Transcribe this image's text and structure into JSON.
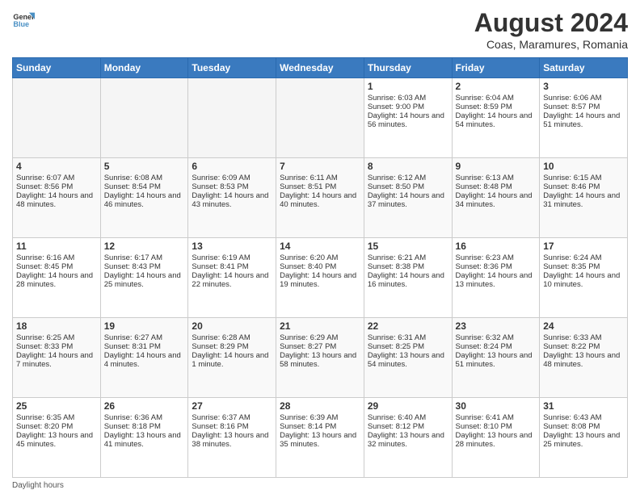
{
  "header": {
    "logo_text_general": "General",
    "logo_text_blue": "Blue",
    "month_year": "August 2024",
    "location": "Coas, Maramures, Romania"
  },
  "days_of_week": [
    "Sunday",
    "Monday",
    "Tuesday",
    "Wednesday",
    "Thursday",
    "Friday",
    "Saturday"
  ],
  "footer_label": "Daylight hours",
  "weeks": [
    [
      {
        "day": "",
        "sunrise": "",
        "sunset": "",
        "daylight": "",
        "empty": true
      },
      {
        "day": "",
        "sunrise": "",
        "sunset": "",
        "daylight": "",
        "empty": true
      },
      {
        "day": "",
        "sunrise": "",
        "sunset": "",
        "daylight": "",
        "empty": true
      },
      {
        "day": "",
        "sunrise": "",
        "sunset": "",
        "daylight": "",
        "empty": true
      },
      {
        "day": "1",
        "sunrise": "6:03 AM",
        "sunset": "9:00 PM",
        "daylight": "14 hours and 56 minutes."
      },
      {
        "day": "2",
        "sunrise": "6:04 AM",
        "sunset": "8:59 PM",
        "daylight": "14 hours and 54 minutes."
      },
      {
        "day": "3",
        "sunrise": "6:06 AM",
        "sunset": "8:57 PM",
        "daylight": "14 hours and 51 minutes."
      }
    ],
    [
      {
        "day": "4",
        "sunrise": "6:07 AM",
        "sunset": "8:56 PM",
        "daylight": "14 hours and 48 minutes."
      },
      {
        "day": "5",
        "sunrise": "6:08 AM",
        "sunset": "8:54 PM",
        "daylight": "14 hours and 46 minutes."
      },
      {
        "day": "6",
        "sunrise": "6:09 AM",
        "sunset": "8:53 PM",
        "daylight": "14 hours and 43 minutes."
      },
      {
        "day": "7",
        "sunrise": "6:11 AM",
        "sunset": "8:51 PM",
        "daylight": "14 hours and 40 minutes."
      },
      {
        "day": "8",
        "sunrise": "6:12 AM",
        "sunset": "8:50 PM",
        "daylight": "14 hours and 37 minutes."
      },
      {
        "day": "9",
        "sunrise": "6:13 AM",
        "sunset": "8:48 PM",
        "daylight": "14 hours and 34 minutes."
      },
      {
        "day": "10",
        "sunrise": "6:15 AM",
        "sunset": "8:46 PM",
        "daylight": "14 hours and 31 minutes."
      }
    ],
    [
      {
        "day": "11",
        "sunrise": "6:16 AM",
        "sunset": "8:45 PM",
        "daylight": "14 hours and 28 minutes."
      },
      {
        "day": "12",
        "sunrise": "6:17 AM",
        "sunset": "8:43 PM",
        "daylight": "14 hours and 25 minutes."
      },
      {
        "day": "13",
        "sunrise": "6:19 AM",
        "sunset": "8:41 PM",
        "daylight": "14 hours and 22 minutes."
      },
      {
        "day": "14",
        "sunrise": "6:20 AM",
        "sunset": "8:40 PM",
        "daylight": "14 hours and 19 minutes."
      },
      {
        "day": "15",
        "sunrise": "6:21 AM",
        "sunset": "8:38 PM",
        "daylight": "14 hours and 16 minutes."
      },
      {
        "day": "16",
        "sunrise": "6:23 AM",
        "sunset": "8:36 PM",
        "daylight": "14 hours and 13 minutes."
      },
      {
        "day": "17",
        "sunrise": "6:24 AM",
        "sunset": "8:35 PM",
        "daylight": "14 hours and 10 minutes."
      }
    ],
    [
      {
        "day": "18",
        "sunrise": "6:25 AM",
        "sunset": "8:33 PM",
        "daylight": "14 hours and 7 minutes."
      },
      {
        "day": "19",
        "sunrise": "6:27 AM",
        "sunset": "8:31 PM",
        "daylight": "14 hours and 4 minutes."
      },
      {
        "day": "20",
        "sunrise": "6:28 AM",
        "sunset": "8:29 PM",
        "daylight": "14 hours and 1 minute."
      },
      {
        "day": "21",
        "sunrise": "6:29 AM",
        "sunset": "8:27 PM",
        "daylight": "13 hours and 58 minutes."
      },
      {
        "day": "22",
        "sunrise": "6:31 AM",
        "sunset": "8:25 PM",
        "daylight": "13 hours and 54 minutes."
      },
      {
        "day": "23",
        "sunrise": "6:32 AM",
        "sunset": "8:24 PM",
        "daylight": "13 hours and 51 minutes."
      },
      {
        "day": "24",
        "sunrise": "6:33 AM",
        "sunset": "8:22 PM",
        "daylight": "13 hours and 48 minutes."
      }
    ],
    [
      {
        "day": "25",
        "sunrise": "6:35 AM",
        "sunset": "8:20 PM",
        "daylight": "13 hours and 45 minutes."
      },
      {
        "day": "26",
        "sunrise": "6:36 AM",
        "sunset": "8:18 PM",
        "daylight": "13 hours and 41 minutes."
      },
      {
        "day": "27",
        "sunrise": "6:37 AM",
        "sunset": "8:16 PM",
        "daylight": "13 hours and 38 minutes."
      },
      {
        "day": "28",
        "sunrise": "6:39 AM",
        "sunset": "8:14 PM",
        "daylight": "13 hours and 35 minutes."
      },
      {
        "day": "29",
        "sunrise": "6:40 AM",
        "sunset": "8:12 PM",
        "daylight": "13 hours and 32 minutes."
      },
      {
        "day": "30",
        "sunrise": "6:41 AM",
        "sunset": "8:10 PM",
        "daylight": "13 hours and 28 minutes."
      },
      {
        "day": "31",
        "sunrise": "6:43 AM",
        "sunset": "8:08 PM",
        "daylight": "13 hours and 25 minutes."
      }
    ]
  ]
}
